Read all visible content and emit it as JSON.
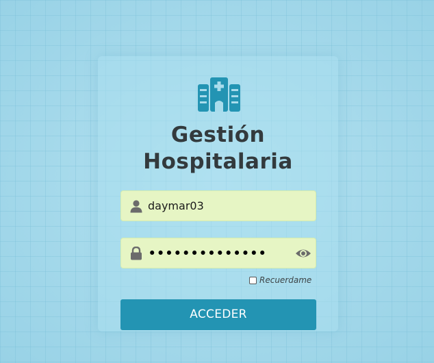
{
  "app": {
    "title_line1": "Gestión",
    "title_line2": "Hospitalaria",
    "logo_icon": "hospital-icon"
  },
  "login": {
    "username_value": "daymar03",
    "username_icon": "user-icon",
    "password_value": "••••••••••••••",
    "password_icon": "lock-icon",
    "reveal_icon": "eye-icon",
    "remember_label": "Recuerdame",
    "remember_checked": false,
    "submit_label": "ACCEDER"
  },
  "colors": {
    "accent": "#2394b3",
    "field_background": "#e6f5c4",
    "title_text": "#333a3d",
    "icon_gray": "#6b6b6b"
  }
}
